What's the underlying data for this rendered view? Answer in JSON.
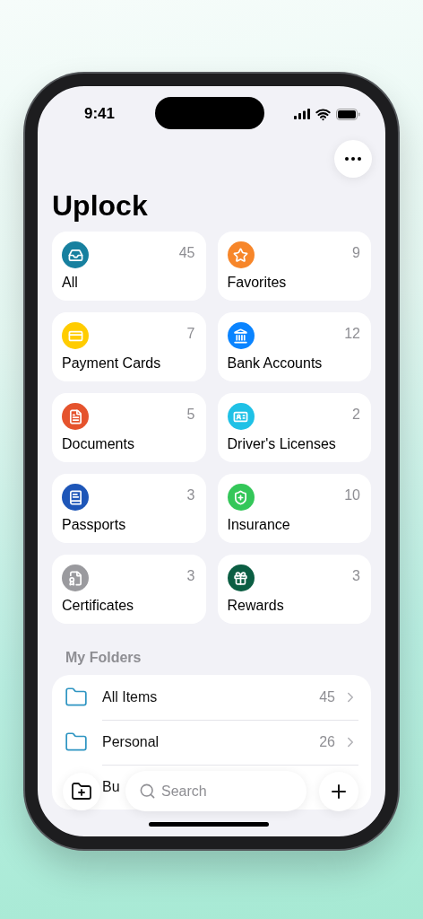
{
  "status_bar": {
    "time": "9:41"
  },
  "title": "Uplock",
  "categories": [
    {
      "label": "All",
      "count": "45",
      "color": "#17809f"
    },
    {
      "label": "Favorites",
      "count": "9",
      "color": "#f7862a"
    },
    {
      "label": "Payment Cards",
      "count": "7",
      "color": "#ffcc00"
    },
    {
      "label": "Bank Accounts",
      "count": "12",
      "color": "#0a84ff"
    },
    {
      "label": "Documents",
      "count": "5",
      "color": "#e5532d"
    },
    {
      "label": "Driver's Licenses",
      "count": "2",
      "color": "#1fc1e6"
    },
    {
      "label": "Passports",
      "count": "3",
      "color": "#1e56b8"
    },
    {
      "label": "Insurance",
      "count": "10",
      "color": "#34c759"
    },
    {
      "label": "Certificates",
      "count": "3",
      "color": "#9a9a9e"
    },
    {
      "label": "Rewards",
      "count": "3",
      "color": "#0b5e43"
    }
  ],
  "folders_heading": "My Folders",
  "folders": [
    {
      "name": "All Items",
      "count": "45"
    },
    {
      "name": "Personal",
      "count": "26"
    },
    {
      "name": "Bu"
    }
  ],
  "search": {
    "placeholder": "Search"
  }
}
